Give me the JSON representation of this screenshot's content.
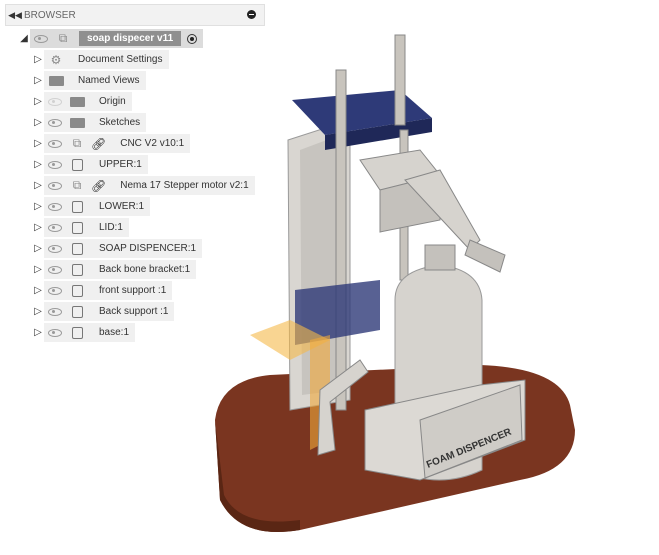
{
  "browser": {
    "title": "BROWSER",
    "root": {
      "label": "soap dispecer v11"
    },
    "items": [
      {
        "label": "Document Settings",
        "icon": "gear-icon",
        "visible": null,
        "link": false
      },
      {
        "label": "Named Views",
        "icon": "folder-icon",
        "visible": null,
        "link": false
      },
      {
        "label": "Origin",
        "icon": "folder-icon",
        "visible": false,
        "link": false
      },
      {
        "label": "Sketches",
        "icon": "folder-icon",
        "visible": true,
        "link": false
      },
      {
        "label": "CNC V2 v10:1",
        "icon": "component-icon",
        "visible": true,
        "link": true
      },
      {
        "label": "UPPER:1",
        "icon": "body-icon",
        "visible": true,
        "link": false
      },
      {
        "label": "Nema 17 Stepper motor v2:1",
        "icon": "component-icon",
        "visible": true,
        "link": true
      },
      {
        "label": "LOWER:1",
        "icon": "body-icon",
        "visible": true,
        "link": false
      },
      {
        "label": "LID:1",
        "icon": "body-icon",
        "visible": true,
        "link": false
      },
      {
        "label": "SOAP DISPENCER:1",
        "icon": "body-icon",
        "visible": true,
        "link": false
      },
      {
        "label": "Back bone bracket:1",
        "icon": "body-icon",
        "visible": true,
        "link": false
      },
      {
        "label": "front support :1",
        "icon": "body-icon",
        "visible": true,
        "link": false
      },
      {
        "label": "Back support :1",
        "icon": "body-icon",
        "visible": true,
        "link": false
      },
      {
        "label": "base:1",
        "icon": "body-icon",
        "visible": true,
        "link": false
      }
    ]
  },
  "model": {
    "embossed_text": "FOAM DISPENCER",
    "colors": {
      "base": "#7a3520",
      "body": "#d8d5d0",
      "plate": "#2e3a78"
    }
  }
}
